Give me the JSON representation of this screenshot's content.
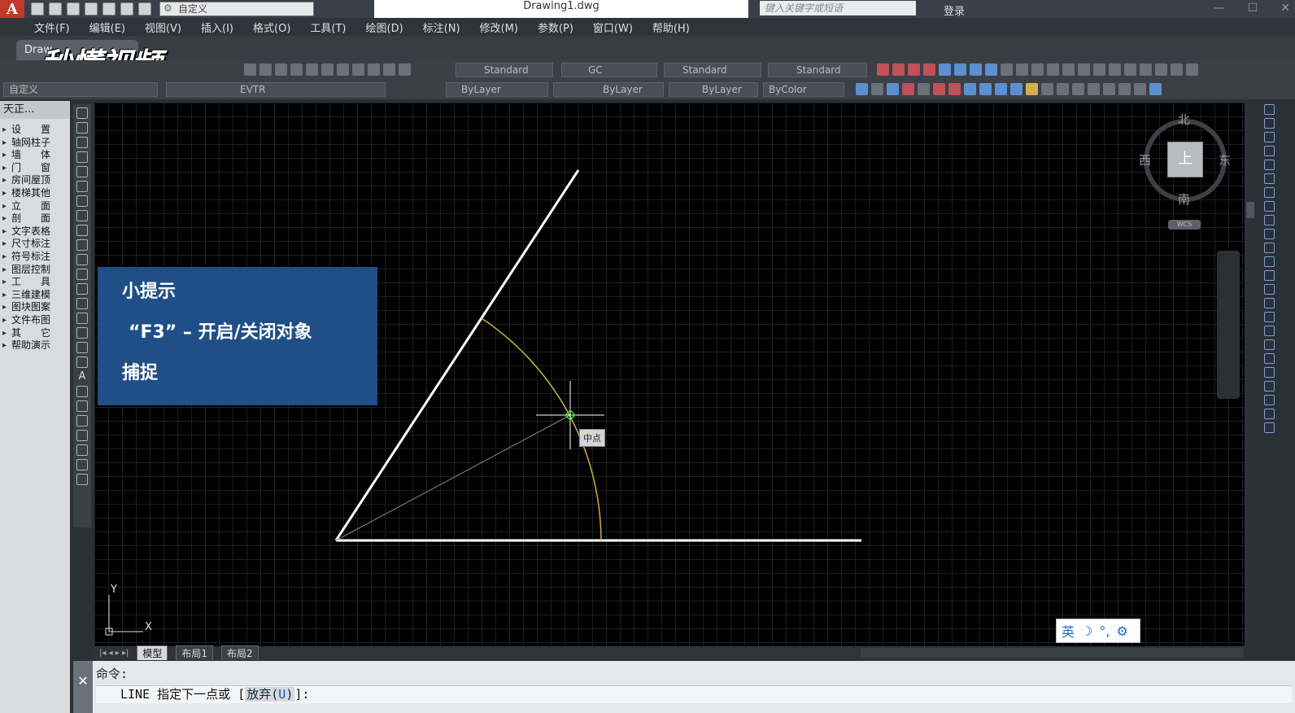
{
  "window": {
    "app_logo": "A",
    "workspace": "自定义",
    "doc_title": "Drawing1.dwg",
    "search_placeholder": "键入关键字或短语",
    "login_label": "登录",
    "controls": [
      "—",
      "☐",
      "✕"
    ]
  },
  "menu": [
    "文件(F)",
    "编辑(E)",
    "视图(V)",
    "插入(I)",
    "格式(O)",
    "工具(T)",
    "绘图(D)",
    "标注(N)",
    "修改(M)",
    "参数(P)",
    "窗口(W)",
    "帮助(H)"
  ],
  "doc_tab": "Draw",
  "watermark": "秒懂视频",
  "toolbar": {
    "text_style": "Standard",
    "dim_style": "GC",
    "table_style": "Standard",
    "multileader_style": "Standard",
    "workspace2": "自定义",
    "layer": "EVTR",
    "color": "ByLayer",
    "linetype": "ByLayer",
    "lineweight": "ByLayer",
    "plotstyle": "ByColor"
  },
  "left_panel": {
    "title": "天正...",
    "items": [
      "设　　置",
      "轴网柱子",
      "墙　　体",
      "门　　窗",
      "房间屋顶",
      "楼梯其他",
      "立　　面",
      "剖　　面",
      "文字表格",
      "尺寸标注",
      "符号标注",
      "图层控制",
      "工　　具",
      "三维建模",
      "图块图案",
      "文件布图",
      "其　　它",
      "帮助演示"
    ]
  },
  "viewcube": {
    "north": "北",
    "south": "南",
    "west": "西",
    "east": "东",
    "face": "上",
    "wcs": "WCS"
  },
  "tip": {
    "line1": "小提示",
    "line2": "“F3” – 开启/关闭对象",
    "line3": "捕捉"
  },
  "snap_label": "中点",
  "ucs": {
    "x": "X",
    "y": "Y"
  },
  "ime": {
    "lang": "英",
    "moon": "☽",
    "punct": "°,",
    "gear": "⚙"
  },
  "layout_tabs": [
    "模型",
    "布局1",
    "布局2"
  ],
  "command": {
    "history": "命令:",
    "prompt_cmd": "LINE",
    "prompt_text": "指定下一点或",
    "option": "放弃",
    "option_key": "U",
    "close": "✕"
  },
  "colors": {
    "canvas": "#000000",
    "tip_bg": "#1f4f86",
    "arc": "#c8b040",
    "snap_marker": "#33dd33"
  }
}
